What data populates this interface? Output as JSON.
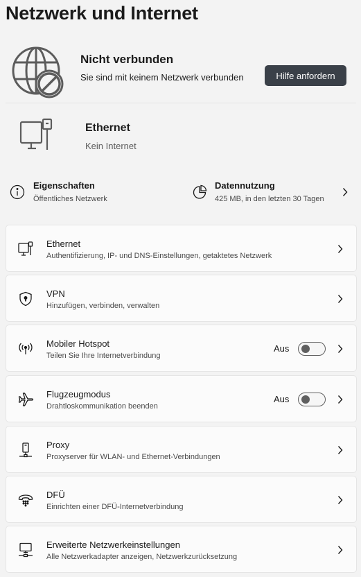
{
  "page": {
    "title": "Netzwerk und Internet"
  },
  "status": {
    "icon": "globe-blocked-icon",
    "title": "Nicht verbunden",
    "subtitle": "Sie sind mit keinem Netzwerk verbunden",
    "help_button": "Hilfe anfordern"
  },
  "ethernet_status": {
    "icon": "ethernet-monitor-icon",
    "title": "Ethernet",
    "subtitle": "Kein Internet"
  },
  "properties": {
    "eigenschaften": {
      "icon": "info-icon",
      "title": "Eigenschaften",
      "subtitle": "Öffentliches Netzwerk"
    },
    "datennutzung": {
      "icon": "pie-chart-icon",
      "title": "Datennutzung",
      "subtitle": "425 MB, in den letzten 30 Tagen"
    }
  },
  "cards": [
    {
      "icon": "ethernet-icon",
      "title": "Ethernet",
      "subtitle": "Authentifizierung, IP- und DNS-Einstellungen, getaktetes Netzwerk"
    },
    {
      "icon": "vpn-shield-icon",
      "title": "VPN",
      "subtitle": "Hinzufügen, verbinden, verwalten"
    },
    {
      "icon": "hotspot-icon",
      "title": "Mobiler Hotspot",
      "subtitle": "Teilen Sie Ihre Internetverbindung",
      "toggle_label": "Aus",
      "toggle_on": false
    },
    {
      "icon": "airplane-icon",
      "title": "Flugzeugmodus",
      "subtitle": "Drahtloskommunikation beenden",
      "toggle_label": "Aus",
      "toggle_on": false
    },
    {
      "icon": "proxy-icon",
      "title": "Proxy",
      "subtitle": "Proxyserver für WLAN- und Ethernet-Verbindungen"
    },
    {
      "icon": "dialup-phone-icon",
      "title": "DFÜ",
      "subtitle": "Einrichten einer DFÜ-Internetverbindung"
    },
    {
      "icon": "network-pc-icon",
      "title": "Erweiterte Netzwerkeinstellungen",
      "subtitle": "Alle Netzwerkadapter anzeigen, Netzwerkzurücksetzung"
    }
  ]
}
